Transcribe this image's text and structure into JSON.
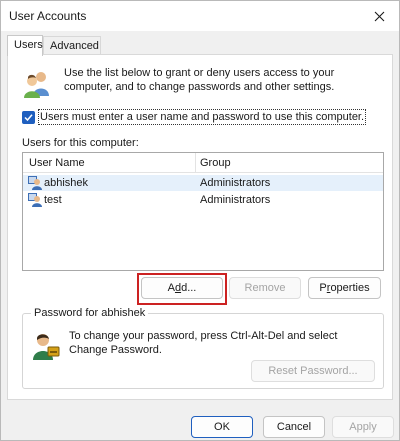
{
  "window": {
    "title": "User Accounts",
    "close_glyph": "close-icon"
  },
  "tabs": [
    {
      "label": "Users",
      "active": true
    },
    {
      "label": "Advanced",
      "active": false
    }
  ],
  "intro": {
    "icon": "users-icon",
    "text": "Use the list below to grant or deny users access to your computer, and to change passwords and other settings."
  },
  "require_password": {
    "checked": true,
    "label": "Users must enter a user name and password to use this computer."
  },
  "users_list": {
    "label": "Users for this computer:",
    "columns": [
      "User Name",
      "Group"
    ],
    "rows": [
      {
        "name": "abhishek",
        "group": "Administrators",
        "selected": true
      },
      {
        "name": "test",
        "group": "Administrators",
        "selected": false
      }
    ]
  },
  "list_buttons": {
    "add": {
      "label": "Add...",
      "accel": "d",
      "pre": "A",
      "post": "d...",
      "enabled": true
    },
    "remove": {
      "label": "Remove",
      "enabled": false
    },
    "properties": {
      "pre": "P",
      "accel": "r",
      "post": "operties",
      "label": "Properties",
      "enabled": true
    }
  },
  "password_group": {
    "title": "Password for abhishek",
    "icon": "password-user-icon",
    "text": "To change your password, press Ctrl-Alt-Del and select Change Password.",
    "reset_label": "Reset Password...",
    "reset_enabled": false
  },
  "footer": {
    "ok": "OK",
    "cancel": "Cancel",
    "apply": "Apply",
    "apply_enabled": false
  },
  "colors": {
    "accent": "#1f5fbf",
    "highlight": "#cc2222",
    "selection": "#e5f0fb"
  }
}
